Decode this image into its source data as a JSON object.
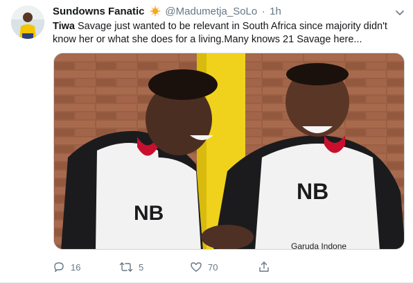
{
  "tweet": {
    "author_name": "Sundowns Fanatic",
    "handle": "@Madumetja_SoLo",
    "separator": "·",
    "time": "1h",
    "text_bold": "Tiwa",
    "text_rest": " Savage just wanted to be relevant in South Africa since majority didn't know her or what she does for a living.Many knows 21 Savage here...",
    "verified_icon": "sun-badge-icon",
    "accent_color": "#f5a623"
  },
  "media": {
    "shirt_sponsor": "Garuda Indone",
    "kit_brand": "NB"
  },
  "actions": {
    "reply_count": "16",
    "retweet_count": "5",
    "like_count": "70",
    "share_icon": "share-icon"
  }
}
